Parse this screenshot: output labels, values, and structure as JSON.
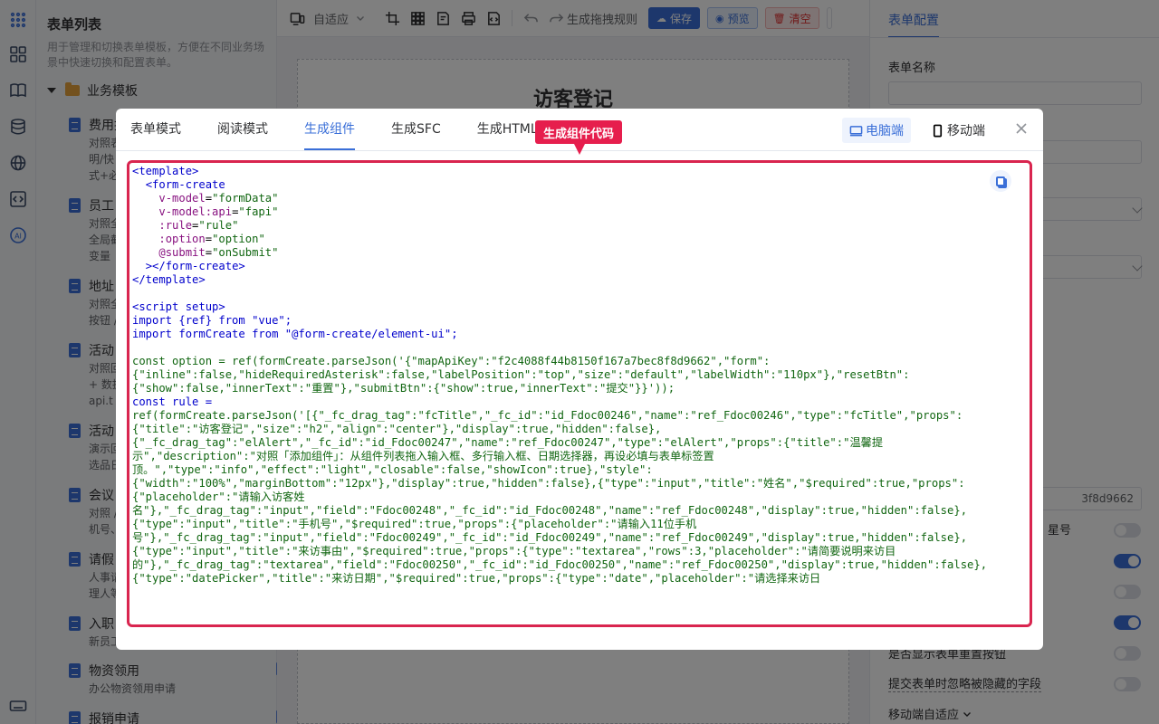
{
  "listpanel": {
    "title": "表单列表",
    "desc": "用于管理和切换表单模板，方便在不同业务场景中快速切换和配置表单。",
    "group": "业务模板",
    "items": [
      {
        "name": "费用报",
        "lines": [
          "对照表",
          "明/快",
          "式+必"
        ]
      },
      {
        "name": "员工",
        "lines": [
          "对照全",
          "全局截",
          "变量"
        ]
      },
      {
        "name": "地址",
        "lines": [
          "对照全",
          "按钮 /"
        ]
      },
      {
        "name": "活动",
        "lines": [
          "对照回",
          "+ 数据",
          "api.t"
        ]
      },
      {
        "name": "活动",
        "lines": [
          "演示回",
          "选品日"
        ]
      },
      {
        "name": "会议",
        "lines": [
          "对照 /",
          "机号、"
        ]
      },
      {
        "name": "请假",
        "lines": [
          "人事请",
          "理人等"
        ]
      },
      {
        "name": "入职",
        "lines": [
          "新员工"
        ]
      },
      {
        "name": "物资领用",
        "lines": [
          "办公物资领用申请"
        ]
      },
      {
        "name": "报销申请",
        "lines": []
      }
    ]
  },
  "toolbar": {
    "mode_select": "自适应",
    "drag_rule": "生成拖拽规则",
    "save": "保存",
    "preview": "预览",
    "clear": "清空"
  },
  "canvas": {
    "form_title": "访客登记"
  },
  "config": {
    "tab": "表单配置",
    "form_name_label": "表单名称",
    "api_key_value": "3f8d9662",
    "labels": [
      "星号",
      "是否显示表单重置按钮",
      "提交表单时忽略被隐藏的字段",
      "移动端自适应"
    ],
    "toggles": [
      false,
      true,
      false,
      true,
      false,
      false
    ]
  },
  "dialog": {
    "tabs": [
      "表单模式",
      "阅读模式",
      "生成组件",
      "生成SFC",
      "生成HTML"
    ],
    "active_tab": 2,
    "desktop": "电脑端",
    "mobile": "移动端",
    "callout": "生成组件代码",
    "code": {
      "template": {
        "open": "<template>",
        "fc_open": "<form-create",
        "attrs": [
          [
            "v-model",
            "\"formData\""
          ],
          [
            "v-model:api",
            "\"fapi\""
          ],
          [
            ":rule",
            "\"rule\""
          ],
          [
            ":option",
            "\"option\""
          ],
          [
            "@submit",
            "\"onSubmit\""
          ]
        ],
        "fc_close": "></form-create>",
        "close": "</template>"
      },
      "script_open": "<script setup>",
      "import_vue": "import {ref} from \"vue\";",
      "import_fc": "import formCreate from \"@form-create/element-ui\";",
      "option_line": "const option = ref(formCreate.parseJson('{\"mapApiKey\":\"f2c4088f44b8150f167a7bec8f8d9662\",\"form\":",
      "json_lines": [
        "{\"inline\":false,\"hideRequiredAsterisk\":false,\"labelPosition\":\"top\",\"size\":\"default\",\"labelWidth\":\"110px\"},\"resetBtn\":",
        "{\"show\":false,\"innerText\":\"重置\"},\"submitBtn\":{\"show\":true,\"innerText\":\"提交\"}}'));",
        "const rule =",
        "ref(formCreate.parseJson('[{\"_fc_drag_tag\":\"fcTitle\",\"_fc_id\":\"id_Fdoc00246\",\"name\":\"ref_Fdoc00246\",\"type\":\"fcTitle\",\"props\":",
        "{\"title\":\"访客登记\",\"size\":\"h2\",\"align\":\"center\"},\"display\":true,\"hidden\":false},",
        "{\"_fc_drag_tag\":\"elAlert\",\"_fc_id\":\"id_Fdoc00247\",\"name\":\"ref_Fdoc00247\",\"type\":\"elAlert\",\"props\":{\"title\":\"温馨提",
        "示\",\"description\":\"对照「添加组件」：从组件列表拖入输入框、多行输入框、日期选择器，再设必填与表单标签置",
        "顶。\",\"type\":\"info\",\"effect\":\"light\",\"closable\":false,\"showIcon\":true},\"style\":",
        "{\"width\":\"100%\",\"marginBottom\":\"12px\"},\"display\":true,\"hidden\":false},{\"type\":\"input\",\"title\":\"姓名\",\"$required\":true,\"props\":",
        "{\"placeholder\":\"请输入访客姓",
        "名\"},\"_fc_drag_tag\":\"input\",\"field\":\"Fdoc00248\",\"_fc_id\":\"id_Fdoc00248\",\"name\":\"ref_Fdoc00248\",\"display\":true,\"hidden\":false},",
        "{\"type\":\"input\",\"title\":\"手机号\",\"$required\":true,\"props\":{\"placeholder\":\"请输入11位手机",
        "号\"},\"_fc_drag_tag\":\"input\",\"field\":\"Fdoc00249\",\"_fc_id\":\"id_Fdoc00249\",\"name\":\"ref_Fdoc00249\",\"display\":true,\"hidden\":false},",
        "{\"type\":\"input\",\"title\":\"来访事由\",\"$required\":true,\"props\":{\"type\":\"textarea\",\"rows\":3,\"placeholder\":\"请简要说明来访目",
        "的\"},\"_fc_drag_tag\":\"textarea\",\"field\":\"Fdoc00250\",\"_fc_id\":\"id_Fdoc00250\",\"name\":\"ref_Fdoc00250\",\"display\":true,\"hidden\":false},",
        "{\"type\":\"datePicker\",\"title\":\"来访日期\",\"$required\":true,\"props\":{\"type\":\"date\",\"placeholder\":\"请选择来访日"
      ]
    }
  }
}
